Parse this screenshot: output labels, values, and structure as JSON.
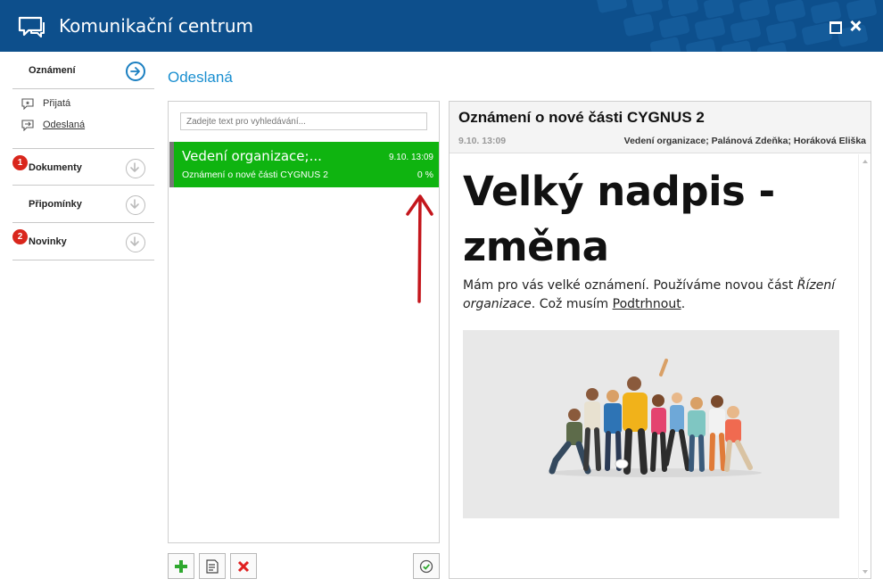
{
  "window": {
    "title": "Komunikační centrum",
    "controls": [
      "maximize-icon",
      "close-icon"
    ],
    "header_color": "#0d4f8c"
  },
  "sidebar": {
    "sections": [
      {
        "label": "Oznámení",
        "state": "active",
        "badge": null,
        "items": [
          {
            "label": "Přijatá",
            "icon": "inbox-star-icon"
          },
          {
            "label": "Odeslaná",
            "icon": "outbox-arrow-icon",
            "selected": true
          }
        ]
      },
      {
        "label": "Dokumenty",
        "badge": "1"
      },
      {
        "label": "Připomínky",
        "badge": null
      },
      {
        "label": "Novinky",
        "badge": "2"
      }
    ],
    "badge_color": "#d9261c",
    "accent_color": "#1a7fc1"
  },
  "page_title": "Odeslaná",
  "list": {
    "search_placeholder": "Zadejte text pro vyhledávání...",
    "messages": [
      {
        "from": "Vedení organizace;...",
        "date": "9.10. 13:09",
        "subject": "Oznámení o nové části CYGNUS 2",
        "percent": "0 %",
        "selected": true
      }
    ],
    "selected_color": "#0fb410"
  },
  "toolbar": {
    "buttons": [
      "add-icon",
      "edit-note-icon",
      "delete-icon",
      "check-circle-icon"
    ]
  },
  "detail": {
    "title": "Oznámení o nové části CYGNUS 2",
    "date": "9.10. 13:09",
    "recipients": "Vedení organizace; Palánová Zdeňka; Horáková Eliška",
    "heading": "Velký nadpis - změna",
    "body": {
      "part1": "Mám pro vás velké oznámení. Používáme novou část ",
      "italic": "Řízení organizace",
      "part2": ". Což musím ",
      "underlined": "Podtrhnout",
      "part3": "."
    }
  }
}
